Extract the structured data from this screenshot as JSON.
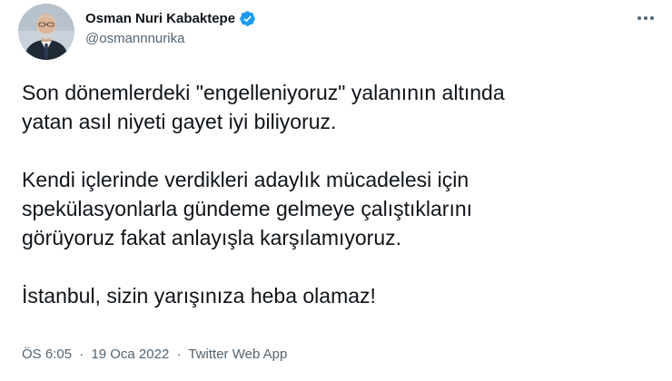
{
  "author": {
    "display_name": "Osman Nuri Kabaktepe",
    "handle": "@osmannnurika",
    "verified": true
  },
  "tweet": {
    "paragraphs": [
      {
        "lines": [
          "Son dönemlerdeki \"engelleniyoruz\" yalanının altında",
          "yatan asıl niyeti gayet iyi biliyoruz."
        ]
      },
      {
        "lines": [
          "Kendi içlerinde verdikleri adaylık mücadelesi için",
          "spekülasyonlarla gündeme gelmeye çalıştıklarını",
          "görüyoruz fakat anlayışla karşılamıyoruz."
        ]
      },
      {
        "lines": [
          "İstanbul, sizin yarışınıza heba olamaz!"
        ]
      }
    ]
  },
  "meta": {
    "time": "ÖS 6:05",
    "separator": "·",
    "date": "19 Oca 2022",
    "source": "Twitter Web App"
  },
  "icons": {
    "verified": "verified-badge-icon",
    "more": "more-horizontal-icon"
  },
  "colors": {
    "verified_blue": "#1d9bf0",
    "text_primary": "#0f1419",
    "text_secondary": "#536471"
  }
}
